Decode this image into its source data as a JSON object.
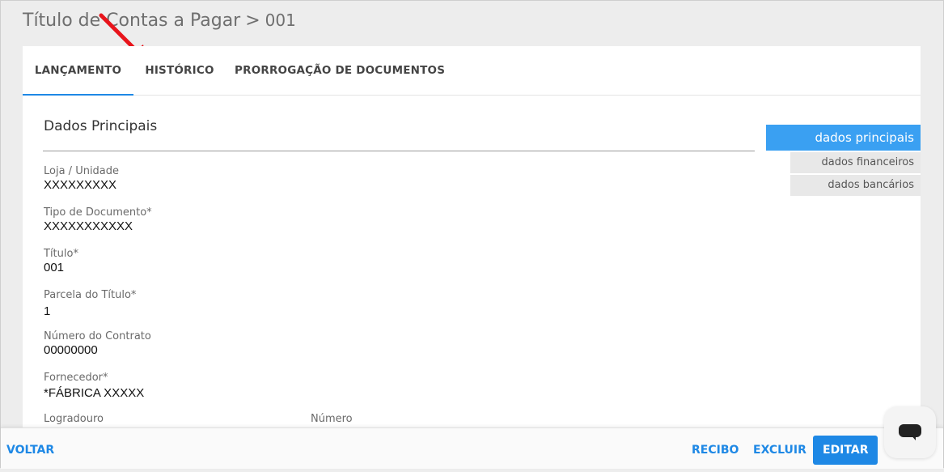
{
  "header": {
    "title": "Título de Contas a Pagar",
    "separator": ">",
    "code": "001"
  },
  "tabs": [
    {
      "label": "LANÇAMENTO"
    },
    {
      "label": "HISTÓRICO"
    },
    {
      "label": "PRORROGAÇÃO DE DOCUMENTOS"
    }
  ],
  "section": {
    "title": "Dados Principais"
  },
  "fields": {
    "loja": {
      "label": "Loja / Unidade",
      "value": "XXXXXXXXX"
    },
    "tipo": {
      "label": "Tipo de Documento*",
      "value": "XXXXXXXXXXX"
    },
    "titulo": {
      "label": "Título*",
      "value": "001"
    },
    "parcela": {
      "label": "Parcela do Título*",
      "value": "1"
    },
    "contrato": {
      "label": "Número do Contrato",
      "value": "00000000"
    },
    "fornecedor": {
      "label": "Fornecedor*",
      "value": "*FÁBRICA XXXXX"
    },
    "logradouro": {
      "label": "Logradouro"
    },
    "numero": {
      "label": "Número"
    }
  },
  "side_nav": [
    {
      "label": "dados principais"
    },
    {
      "label": "dados financeiros"
    },
    {
      "label": "dados bancários"
    }
  ],
  "footer": {
    "back": "VOLTAR",
    "receipt": "RECIBO",
    "delete": "EXCLUIR",
    "edit": "EDITAR"
  },
  "colors": {
    "accent": "#1e88e5",
    "annotation_arrow": "#e8141b"
  },
  "icons": {
    "chat": "chat-bubble-icon",
    "annotation": "red-arrow-icon"
  }
}
